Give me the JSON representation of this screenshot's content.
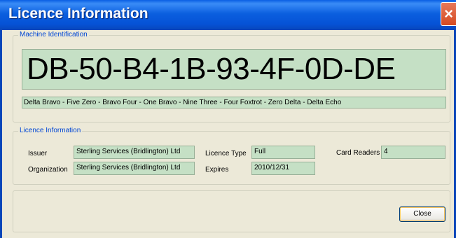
{
  "window": {
    "title": "Licence Information",
    "close_glyph": "×"
  },
  "machine": {
    "group_label": "Machine Identification",
    "id": "DB-50-B4-1B-93-4F-0D-DE",
    "phonetic": "Delta Bravo -   Five Zero -   Bravo Four -   One Bravo -   Nine Three -   Four Foxtrot -   Zero Delta -   Delta Echo"
  },
  "licence": {
    "group_label": "Licence Information",
    "issuer_label": "Issuer",
    "issuer_value": "Sterling Services (Bridlington) Ltd",
    "organization_label": "Organization",
    "organization_value": "Sterling Services (Bridlington) Ltd",
    "licence_type_label": "Licence Type",
    "licence_type_value": "Full",
    "expires_label": "Expires",
    "expires_value": "2010/12/31",
    "card_readers_label": "Card Readers",
    "card_readers_value": "4"
  },
  "buttons": {
    "close_label": "Close"
  }
}
